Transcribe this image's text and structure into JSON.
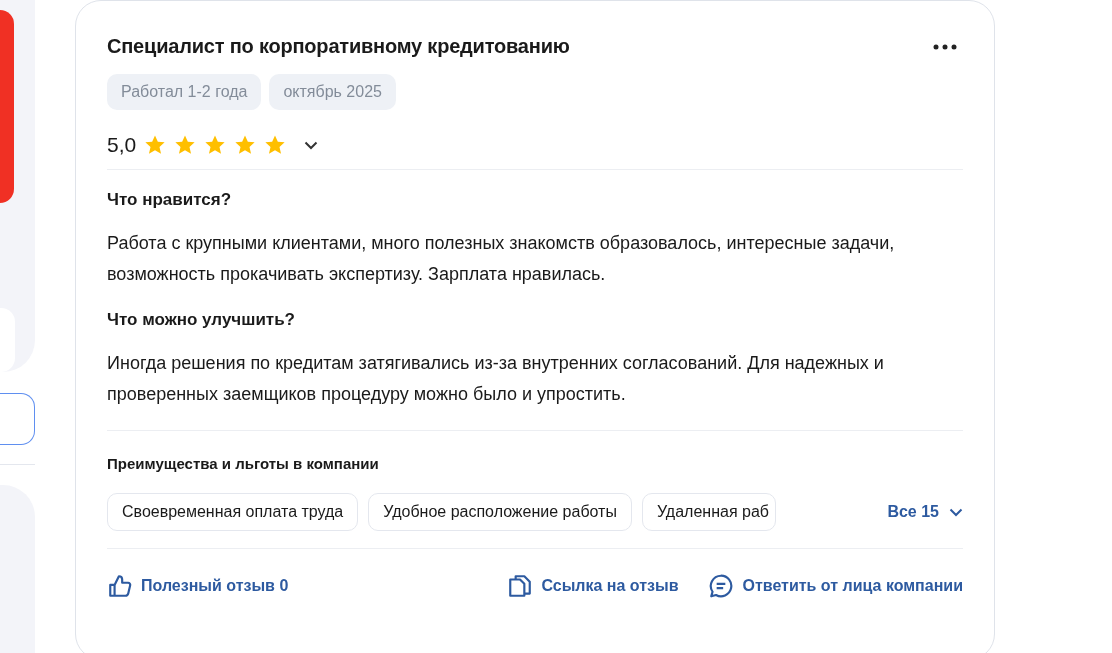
{
  "review": {
    "title": "Специалист по корпоративному кредитованию",
    "tags": [
      "Работал 1-2 года",
      "октябрь 2025"
    ],
    "rating": "5,0",
    "stars": 5,
    "sections": [
      {
        "heading": "Что нравится?",
        "text": "Работа с крупными клиентами, много полезных знакомств образовалось, интересные задачи, возможность прокачивать экспертизу. Зарплата нравилась."
      },
      {
        "heading": "Что можно улучшить?",
        "text": "Иногда решения по кредитам затягивались из-за внутренних согласований. Для надежных и проверенных заемщиков процедуру можно было и упростить."
      }
    ],
    "benefits": {
      "heading": "Преимущества и льготы в компании",
      "items": [
        "Своевременная оплата труда",
        "Удобное расположение работы",
        "Удаленная раб"
      ],
      "more": "Все 15"
    },
    "actions": [
      {
        "kind": "like",
        "label": "Полезный отзыв 0"
      },
      {
        "kind": "link",
        "label": "Ссылка на отзыв"
      },
      {
        "kind": "reply",
        "label": "Ответить от лица компании"
      }
    ]
  }
}
